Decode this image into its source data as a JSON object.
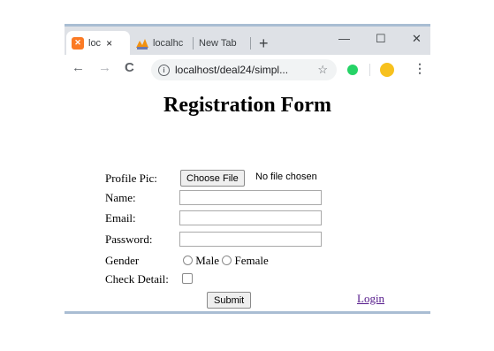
{
  "browser": {
    "tabs": [
      {
        "label": "loc",
        "icon": "xampp-icon",
        "active": true
      },
      {
        "label": "localhc",
        "icon": "phpmyadmin-icon",
        "active": false
      },
      {
        "label": "New Tab",
        "active": false
      }
    ],
    "tab_close": "×",
    "new_tab": "+",
    "window_controls": {
      "minimize": "—",
      "maximize": "☐",
      "close": "✕"
    },
    "nav": {
      "back": "←",
      "forward": "→",
      "reload": "C"
    },
    "url": "localhost/deal24/simpl...",
    "bookmark_star": "☆",
    "menu": "⋮",
    "accent_colors": {
      "tab_strip": "#dee1e6",
      "border": "#a9bdd3",
      "link": "#551a8b"
    }
  },
  "form": {
    "title": "Registration Form",
    "profile_pic_label": "Profile Pic:",
    "choose_file_label": "Choose File",
    "no_file_text": "No file chosen",
    "name_label": "Name:",
    "name_value": "",
    "email_label": "Email:",
    "email_value": "",
    "password_label": "Password:",
    "password_value": "",
    "gender_label": "Gender",
    "gender_options": [
      "Male",
      "Female"
    ],
    "check_label": "Check Detail:",
    "submit_label": "Submit",
    "login_label": "Login"
  }
}
